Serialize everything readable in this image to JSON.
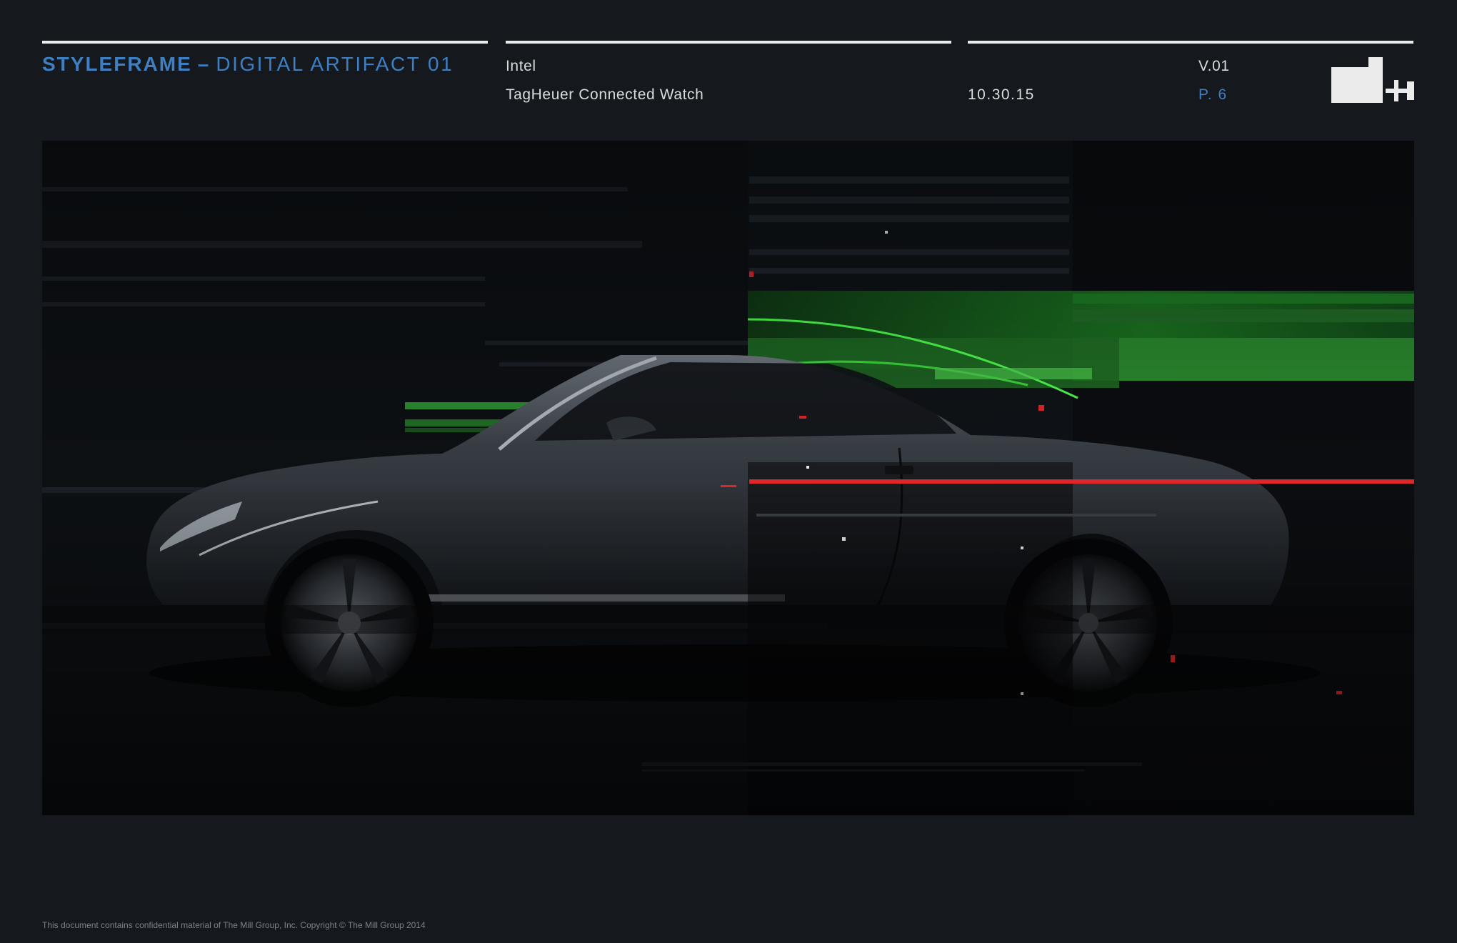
{
  "header": {
    "title_bold": "STYLEFRAME",
    "title_sep": "–",
    "title_light": "DIGITAL ARTIFACT 01",
    "client": "Intel",
    "project": "TagHeuer Connected Watch",
    "date": "10.30.15",
    "version": "V.01",
    "page": "P. 6"
  },
  "logo": {
    "icon": "mill-plus-logo-icon",
    "color": "#ebebeb"
  },
  "styleframe": {
    "subject": "car-glitch-artwork",
    "accent_green": "#3cd93c",
    "accent_red": "#e0262b"
  },
  "colors": {
    "background": "#15191e",
    "accent_blue": "#3d7fc2",
    "rule": "#e9ebec"
  },
  "footer": {
    "text": "This document contains confidential material of The Mill Group, Inc. Copyright © The Mill Group 2014"
  }
}
